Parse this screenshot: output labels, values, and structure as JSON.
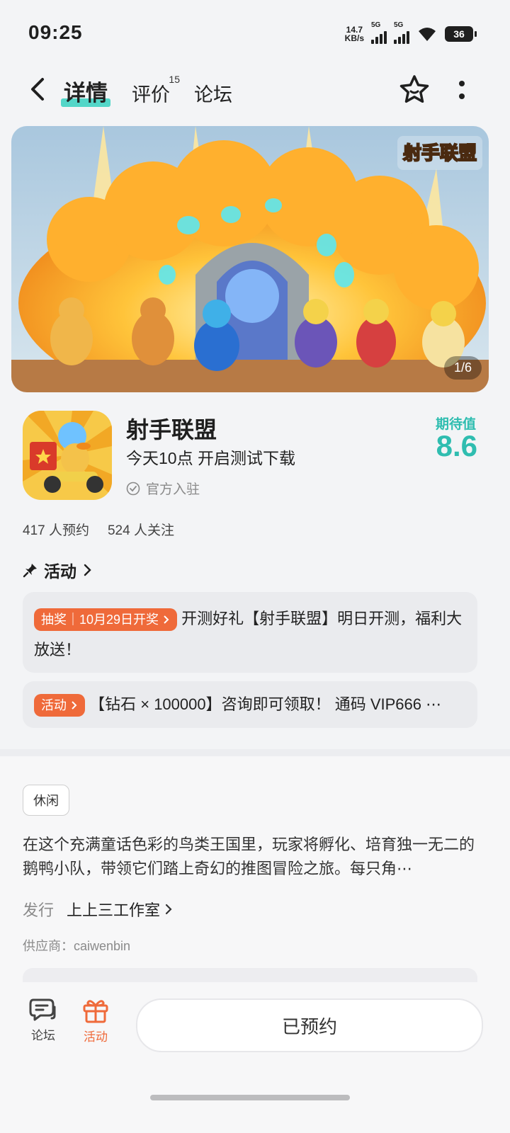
{
  "status_bar": {
    "time": "09:25",
    "net_speed_top": "14.7",
    "net_speed_bottom": "KB/s",
    "sim1_label": "5G",
    "sim2_label": "5G",
    "battery": "36"
  },
  "nav": {
    "tabs": [
      {
        "label": "详情",
        "active": true
      },
      {
        "label": "评价",
        "badge": "15"
      },
      {
        "label": "论坛"
      }
    ]
  },
  "banner": {
    "logo_text": "射手联盟",
    "counter": "1/6"
  },
  "app": {
    "name": "射手联盟",
    "subtitle": "今天10点 开启测试下载",
    "verified": "官方入驻",
    "score_label": "期待值",
    "score_value": "8.6"
  },
  "stats": {
    "reserves": "417 人预约",
    "followers": "524 人关注"
  },
  "activity_section": {
    "title": "活动"
  },
  "activities": [
    {
      "pill": "抽奖｜10月29日开奖",
      "text": "开测好礼【射手联盟】明日开测，福利大放送！"
    },
    {
      "pill": "活动",
      "text": "【钻石 × 100000】咨询即可领取！ 通码 VIP666 ⋯"
    }
  ],
  "detail": {
    "tag": "休闲",
    "description": "在这个充满童话色彩的鸟类王国里，玩家将孵化、培育独一无二的鹅鸭小队，带领它们踏上奇幻的推图冒险之旅。每只角⋯",
    "publisher_label": "发行",
    "publisher_value": "上上三工作室",
    "vendor": "供应商：caiwenbin"
  },
  "bottom_bar": {
    "forum_label": "论坛",
    "activity_label": "活动",
    "reserve_button": "已预约"
  },
  "colors": {
    "accent_teal": "#2fbdb0",
    "accent_orange": "#ef6a3a"
  }
}
